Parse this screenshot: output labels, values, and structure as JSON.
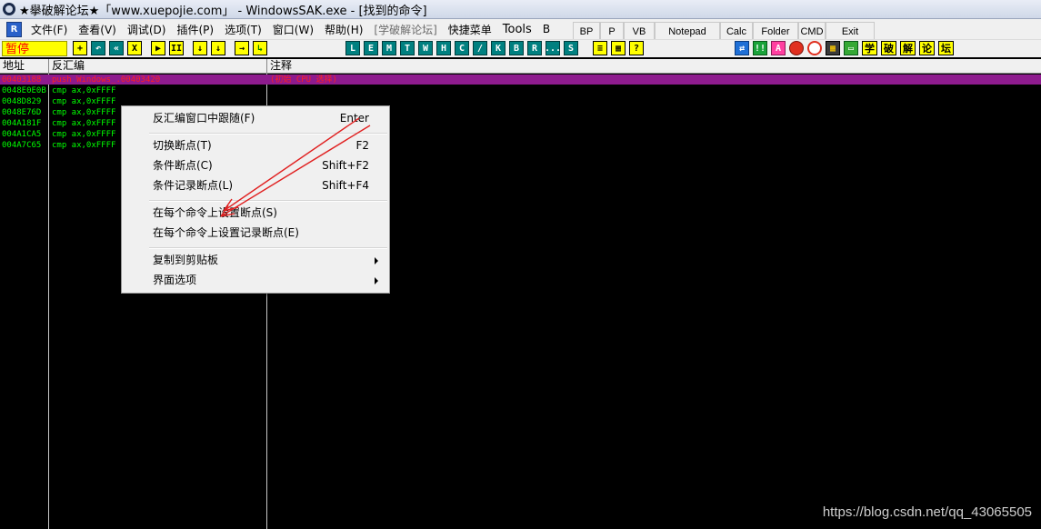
{
  "window": {
    "title": "★擧破解论坛★「www.xuepojie.com」 - WindowsSAK.exe - [找到的命令]"
  },
  "menubar": {
    "r_icon": "R",
    "items": [
      "文件(F)",
      "查看(V)",
      "调试(D)",
      "插件(P)",
      "选项(T)",
      "窗口(W)",
      "帮助(H)",
      "[学破解论坛]",
      "快捷菜单",
      "Tools",
      "B"
    ]
  },
  "plugin_buttons": [
    "BP",
    "P",
    "VB",
    "Notepad",
    "Calc",
    "Folder",
    "CMD",
    "Exit"
  ],
  "toolbar": {
    "status": "暂停",
    "debug_buttons": [
      "+",
      "↶",
      "«",
      "X",
      "▶",
      "II",
      "↓",
      "↓",
      "→",
      "↳"
    ],
    "window_buttons": [
      "L",
      "E",
      "M",
      "T",
      "W",
      "H",
      "C",
      "/",
      "K",
      "B",
      "R",
      "...",
      "S"
    ],
    "extra_buttons": [
      "≡",
      "▦",
      "?"
    ],
    "right_icons": [
      "refresh-icon",
      "numeric-icon",
      "font-icon",
      "record-icon",
      "target-icon",
      "chip-icon",
      "screen-icon"
    ],
    "right_labels": [
      "学",
      "破",
      "解",
      "论",
      "坛"
    ]
  },
  "columns": {
    "address": "地址",
    "disassembly": "反汇编",
    "comment": "注释"
  },
  "rows": [
    {
      "address": "00403188",
      "disasm": "push Windows_.00403420",
      "comment": "(初始 CPU 选择)",
      "selected": true
    },
    {
      "address": "0048E0E0B",
      "disasm": "cmp ax,0xFFFF",
      "comment": "",
      "selected": false
    },
    {
      "address": "0048D829",
      "disasm": "cmp ax,0xFFFF",
      "comment": "",
      "selected": false
    },
    {
      "address": "0048E76D",
      "disasm": "cmp ax,0xFFFF",
      "comment": "",
      "selected": false
    },
    {
      "address": "004A181F",
      "disasm": "cmp ax,0xFFFF",
      "comment": "",
      "selected": false
    },
    {
      "address": "004A1CA5",
      "disasm": "cmp ax,0xFFFF",
      "comment": "",
      "selected": false
    },
    {
      "address": "004A7C65",
      "disasm": "cmp ax,0xFFFF",
      "comment": "",
      "selected": false
    }
  ],
  "context_menu": {
    "items": [
      {
        "label": "反汇编窗口中跟随(F)",
        "shortcut": "Enter",
        "submenu": false
      },
      {
        "label": "切换断点(T)",
        "shortcut": "F2",
        "submenu": false
      },
      {
        "label": "条件断点(C)",
        "shortcut": "Shift+F2",
        "submenu": false
      },
      {
        "label": "条件记录断点(L)",
        "shortcut": "Shift+F4",
        "submenu": false
      },
      {
        "label": "在每个命令上设置断点(S)",
        "shortcut": "",
        "submenu": false
      },
      {
        "label": "在每个命令上设置记录断点(E)",
        "shortcut": "",
        "submenu": false
      },
      {
        "label": "复制到剪贴板",
        "shortcut": "",
        "submenu": true
      },
      {
        "label": "界面选项",
        "shortcut": "",
        "submenu": true
      }
    ]
  },
  "colors": {
    "selected_row_bg": "#8e1b8e",
    "selected_text": "#ff2020",
    "code_text": "#00ff00",
    "annotation_arrow": "#e02020",
    "status_bg": "#ffff00",
    "status_text": "#ff0000"
  },
  "watermark": "https://blog.csdn.net/qq_43065505"
}
